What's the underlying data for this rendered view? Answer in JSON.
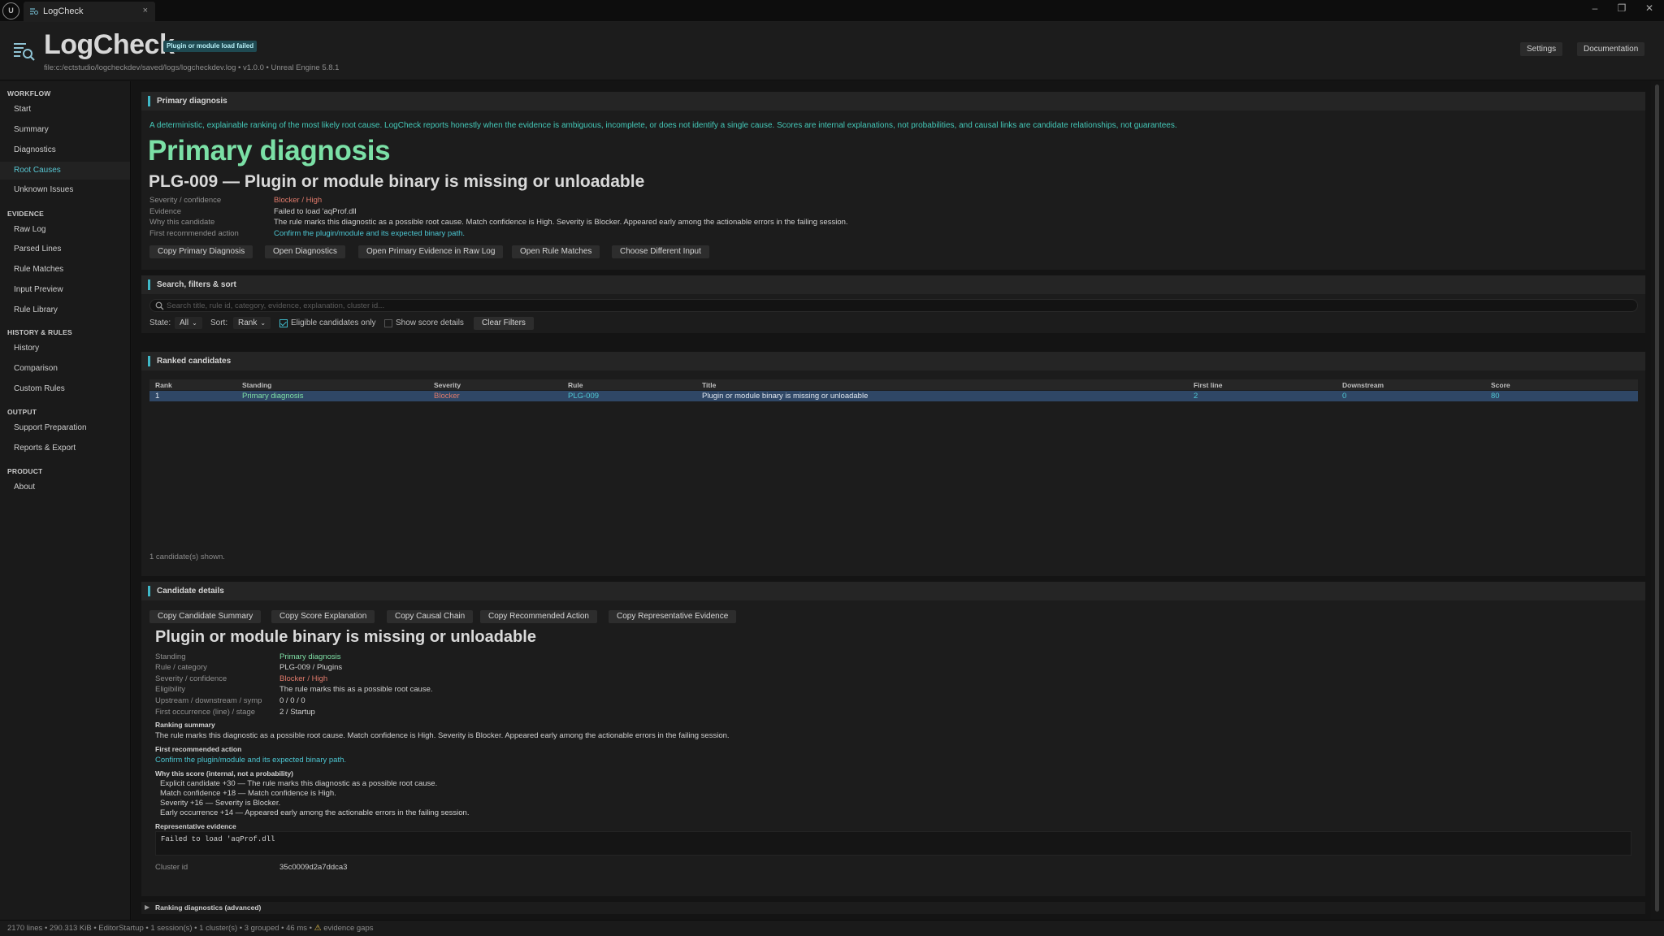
{
  "window": {
    "logo_text": "U",
    "tab_label": "LogCheck",
    "tab_close": "×",
    "minimize": "–",
    "restore": "❐",
    "close": "✕"
  },
  "header": {
    "title": "LogCheck",
    "badge": "Plugin or module load failed",
    "subtitle": "file:c:/ectstudio/logcheckdev/saved/logs/logcheckdev.log  •  v1.0.0  •  Unreal Engine 5.8.1",
    "settings": "Settings",
    "documentation": "Documentation"
  },
  "sidebar": {
    "sections": {
      "workflow": "WORKFLOW",
      "evidence": "EVIDENCE",
      "history": "HISTORY & RULES",
      "output": "OUTPUT",
      "product": "PRODUCT"
    },
    "items": {
      "start": "Start",
      "summary": "Summary",
      "diagnostics": "Diagnostics",
      "root_causes": "Root Causes",
      "unknown": "Unknown Issues",
      "raw_log": "Raw Log",
      "parsed_lines": "Parsed Lines",
      "rule_matches": "Rule Matches",
      "input_preview": "Input Preview",
      "rule_library": "Rule Library",
      "history": "History",
      "comparison": "Comparison",
      "custom_rules": "Custom Rules",
      "support_prep": "Support Preparation",
      "reports_export": "Reports & Export",
      "about": "About"
    }
  },
  "primary": {
    "panel_title": "Primary diagnosis",
    "intro": "A deterministic, explainable ranking of the most likely root cause. LogCheck reports honestly when the evidence is ambiguous, incomplete, or does not identify a single cause. Scores are internal explanations, not probabilities, and causal links are candidate relationships, not guarantees.",
    "heading": "Primary diagnosis",
    "rule_title": "PLG-009  —  Plugin or module binary is missing or unloadable",
    "labels": {
      "severity": "Severity / confidence",
      "evidence": "Evidence",
      "why": "Why this candidate",
      "action": "First recommended action"
    },
    "values": {
      "severity": "Blocker / High",
      "evidence": "Failed to load 'aqProf.dll",
      "why": "The rule marks this diagnostic as a possible root cause. Match confidence is High. Severity is Blocker. Appeared early among the actionable errors in the failing session.",
      "action": "Confirm the plugin/module and its expected binary path."
    },
    "buttons": {
      "copy": "Copy Primary Diagnosis",
      "open_diag": "Open Diagnostics",
      "open_raw": "Open Primary Evidence in Raw Log",
      "open_rules": "Open Rule Matches",
      "choose": "Choose Different Input"
    }
  },
  "search": {
    "panel_title": "Search, filters & sort",
    "placeholder": "Search title, rule id, category, evidence, explanation, cluster id...",
    "state_label": "State:",
    "state_value": "All",
    "sort_label": "Sort:",
    "sort_value": "Rank",
    "eligible_label": "Eligible candidates only",
    "eligible_checked": true,
    "score_label": "Show score details",
    "score_checked": false,
    "clear": "Clear Filters"
  },
  "ranked": {
    "panel_title": "Ranked candidates",
    "columns": {
      "rank": "Rank",
      "standing": "Standing",
      "severity": "Severity",
      "rule": "Rule",
      "title": "Title",
      "first_line": "First line",
      "downstream": "Downstream",
      "score": "Score"
    },
    "rows": [
      {
        "rank": "1",
        "standing": "Primary diagnosis",
        "severity": "Blocker",
        "rule": "PLG-009",
        "title": "Plugin or module binary is missing or unloadable",
        "first_line": "2",
        "downstream": "0",
        "score": "80"
      }
    ],
    "count_text": "1 candidate(s) shown."
  },
  "details": {
    "panel_title": "Candidate details",
    "buttons": {
      "summary": "Copy Candidate Summary",
      "score": "Copy Score Explanation",
      "chain": "Copy Causal Chain",
      "action": "Copy Recommended Action",
      "evidence": "Copy Representative Evidence"
    },
    "title": "Plugin or module binary is missing or unloadable",
    "labels": {
      "standing": "Standing",
      "rule": "Rule / category",
      "severity": "Severity / confidence",
      "eligibility": "Eligibility",
      "updown": "Upstream / downstream / symp",
      "first": "First occurrence (line) / stage"
    },
    "values": {
      "standing": "Primary diagnosis",
      "rule": "PLG-009 / Plugins",
      "severity": "Blocker / High",
      "eligibility": "The rule marks this as a possible root cause.",
      "updown": "0 / 0 / 0",
      "first": "2 / Startup"
    },
    "ranking_summary_head": "Ranking summary",
    "ranking_summary": "The rule marks this diagnostic as a possible root cause. Match confidence is High. Severity is Blocker. Appeared early among the actionable errors in the failing session.",
    "action_head": "First recommended action",
    "action": "Confirm the plugin/module and its expected binary path.",
    "score_head": "Why this score (internal, not a probability)",
    "score_lines": [
      "Explicit candidate +30  —  The rule marks this diagnostic as a possible root cause.",
      "Match confidence +18  —  Match confidence is High.",
      "Severity +16  —  Severity is Blocker.",
      "Early occurrence +14  —  Appeared early among the actionable errors in the failing session."
    ],
    "evidence_head": "Representative evidence",
    "evidence_code": "Failed to load 'aqProf.dll",
    "cluster_label": "Cluster id",
    "cluster_value": "35c0009d2a7ddca3"
  },
  "advanced": {
    "label": "Ranking diagnostics (advanced)"
  },
  "status": {
    "text": "2170 lines  •  290.313 KiB  •  EditorStartup  •  1 session(s)  •  1 cluster(s)  •  3 grouped  •  46 ms  •",
    "warn": "evidence gaps"
  },
  "colors": {
    "accent": "#3fb8c8",
    "heading_green": "#7be0a6",
    "blocker_red": "#e07a6b",
    "selected_row": "#2f4766",
    "warning": "#e6c14a"
  }
}
